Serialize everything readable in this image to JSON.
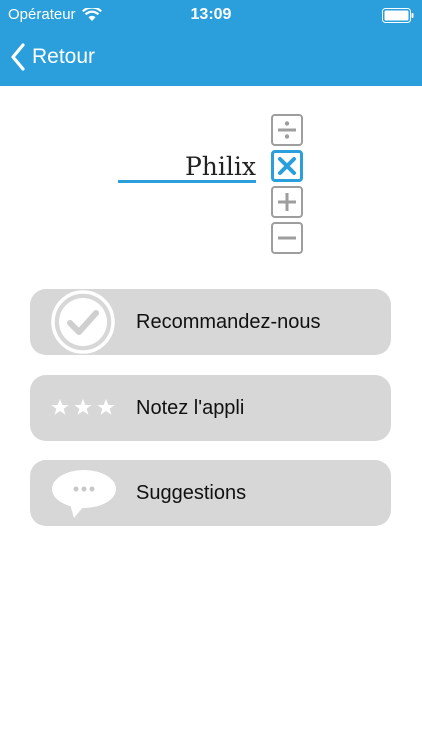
{
  "status_bar": {
    "carrier": "Opérateur",
    "time": "13:09"
  },
  "nav": {
    "back_label": "Retour"
  },
  "logo": {
    "text": "Philix"
  },
  "operators": [
    {
      "name": "divide",
      "active": false
    },
    {
      "name": "multiply",
      "active": true
    },
    {
      "name": "plus",
      "active": false
    },
    {
      "name": "minus",
      "active": false
    }
  ],
  "menu": [
    {
      "label": "Recommandez-nous",
      "icon": "check-circle-icon"
    },
    {
      "label": "Notez l'appli",
      "icon": "stars-icon"
    },
    {
      "label": "Suggestions",
      "icon": "speech-bubble-icon"
    }
  ],
  "colors": {
    "accent": "#2a9fdc",
    "button_bg": "#d7d7d7",
    "icon_gray": "#9e9e9e"
  }
}
